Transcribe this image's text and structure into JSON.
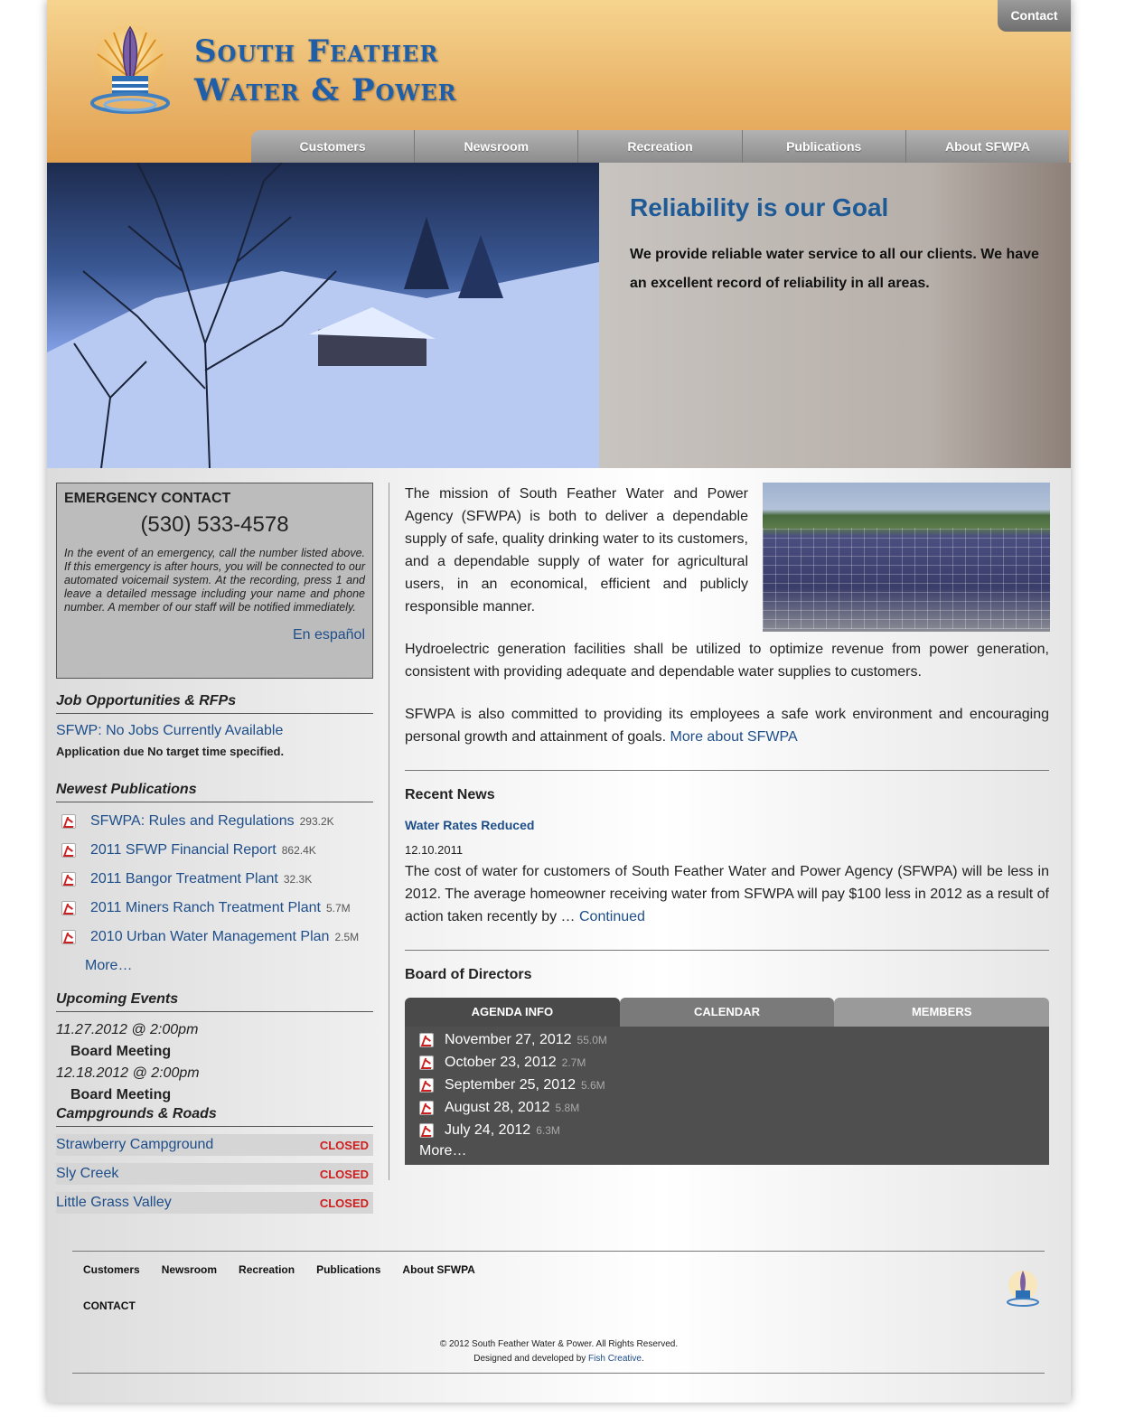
{
  "brand": {
    "line1": "South Feather",
    "line2": "Water & Power",
    "accent": "#1f5ea8"
  },
  "header": {
    "contact_label": "Contact"
  },
  "nav": {
    "items": [
      "Customers",
      "Newsroom",
      "Recreation",
      "Publications",
      "About SFWPA"
    ]
  },
  "hero": {
    "title": "Reliability is our Goal",
    "text": "We provide reliable water service to all our clients. We have an excellent record of reliability in all areas."
  },
  "emergency": {
    "title": "EMERGENCY CONTACT",
    "phone": "(530) 533-4578",
    "text": "In the event of an emergency, call the number listed above. If this emergency is after hours, you will be connected to our automated voicemail system. At the recording, press 1 and leave a detailed message including your name and phone number. A member of our staff will be notified immediately.",
    "spanish_link": "En español"
  },
  "jobs": {
    "title": "Job Opportunities & RFPs",
    "link": "SFWP: No Jobs Currently Available",
    "note": "Application due No target time specified."
  },
  "publications": {
    "title": "Newest Publications",
    "items": [
      {
        "name": "SFWPA: Rules and Regulations",
        "size": "293.2K"
      },
      {
        "name": "2011 SFWP Financial Report",
        "size": "862.4K"
      },
      {
        "name": "2011 Bangor Treatment Plant",
        "size": "32.3K"
      },
      {
        "name": "2011 Miners Ranch Treatment Plant",
        "size": "5.7M"
      },
      {
        "name": "2010 Urban Water Management Plan",
        "size": "2.5M"
      }
    ],
    "more": "More…"
  },
  "events": {
    "title": "Upcoming Events",
    "items": [
      {
        "date": "11.27.2012 @ 2:00pm",
        "name": "Board Meeting"
      },
      {
        "date": "12.18.2012 @ 2:00pm",
        "name": "Board Meeting"
      }
    ]
  },
  "campgrounds": {
    "title": "Campgrounds & Roads",
    "items": [
      {
        "name": "Strawberry Campground",
        "status": "CLOSED"
      },
      {
        "name": "Sly Creek",
        "status": "CLOSED"
      },
      {
        "name": "Little Grass Valley",
        "status": "CLOSED"
      }
    ]
  },
  "main": {
    "mission": "The mission of South Feather Water and Power Agency (SFWPA) is both to deliver a dependable supply of safe, quality drinking water to its customers, and a dependable supply of water for agricultural users, in an economical, efficient and publicly responsible manner.",
    "hydro": "Hydroelectric generation facilities shall be utilized to optimize revenue from power generation, consistent with providing adequate and dependable water supplies to customers.",
    "employees": "SFWPA is also committed to providing its employees a safe work environment and encouraging personal growth and attainment of goals.",
    "more_about": "More about SFWPA"
  },
  "news": {
    "title": "Recent News",
    "headline": "Water Rates Reduced",
    "date": "12.10.2011",
    "body": "The cost of water for customers of South Feather Water and Power Agency (SFWPA) will be less in 2012. The average homeowner receiving water from SFWPA will pay $100 less in 2012 as a result of action taken recently by …",
    "continued": "Continued"
  },
  "board": {
    "title": "Board of Directors",
    "tabs": [
      "AGENDA INFO",
      "CALENDAR",
      "MEMBERS"
    ],
    "agenda": [
      {
        "date": "November 27, 2012",
        "size": "55.0M"
      },
      {
        "date": "October 23, 2012",
        "size": "2.7M"
      },
      {
        "date": "September 25, 2012",
        "size": "5.6M"
      },
      {
        "date": "August 28, 2012",
        "size": "5.8M"
      },
      {
        "date": "July 24, 2012",
        "size": "6.3M"
      }
    ],
    "more": "More…"
  },
  "footer": {
    "nav": [
      "Customers",
      "Newsroom",
      "Recreation",
      "Publications",
      "About SFWPA"
    ],
    "contact": "CONTACT",
    "copyright": "© 2012 South Feather Water & Power. All Rights Reserved.",
    "designed_prefix": "Designed and developed by",
    "designer": "Fish Creative"
  }
}
